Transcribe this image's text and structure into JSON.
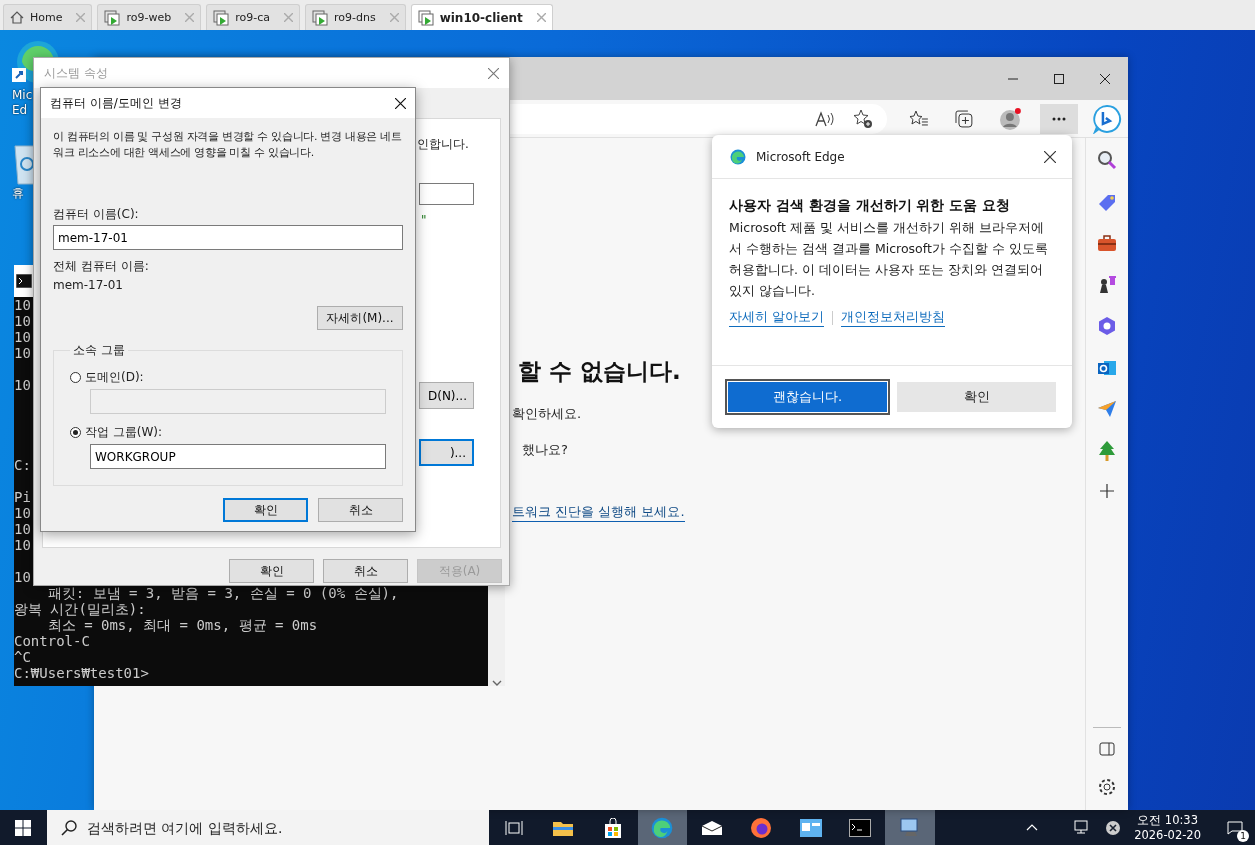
{
  "vm_tabs": [
    {
      "label": "Home",
      "kind": "home",
      "selected": false
    },
    {
      "label": "ro9-web",
      "kind": "vm",
      "selected": false
    },
    {
      "label": "ro9-ca",
      "kind": "vm",
      "selected": false
    },
    {
      "label": "ro9-dns",
      "kind": "vm",
      "selected": false
    },
    {
      "label": "win10-client",
      "kind": "vm",
      "selected": true
    }
  ],
  "desktop_icons": [
    {
      "kind": "edge",
      "label_lines": [
        "Mic",
        "Ed"
      ]
    },
    {
      "kind": "recycle",
      "label_lines": [
        "휴"
      ]
    }
  ],
  "edge_window": {
    "page": {
      "heading": "할 수 없습니다.",
      "lines": [
        "확인하세요.",
        "했나요?"
      ],
      "link": "트워크 진단을 실행해 보세요."
    },
    "popup": {
      "app_name": "Microsoft Edge",
      "heading": "사용자 검색 환경을 개선하기 위한 도움 요청",
      "body": "Microsoft 제품 및 서비스를 개선하기 위해 브라우저에서 수행하는 검색 결과를 Microsoft가 수집할 수 있도록 허용합니다. 이 데이터는 사용자 또는 장치와 연결되어 있지 않습니다.",
      "links": [
        "자세히 알아보기",
        "개인정보처리방침"
      ],
      "buttons": [
        {
          "label": "괜찮습니다.",
          "primary": true
        },
        {
          "label": "확인",
          "primary": false
        }
      ]
    }
  },
  "cmd": {
    "rows": [
      {
        "kind": "text",
        "text": "10"
      },
      {
        "kind": "text",
        "text": "10"
      },
      {
        "kind": "text",
        "text": "10"
      },
      {
        "kind": "text",
        "text": "10"
      },
      {
        "kind": "blank"
      },
      {
        "kind": "text",
        "text": "10"
      },
      {
        "kind": "blank"
      },
      {
        "kind": "blank"
      },
      {
        "kind": "blank"
      },
      {
        "kind": "blank"
      },
      {
        "kind": "text",
        "text": "C:"
      },
      {
        "kind": "blank"
      },
      {
        "kind": "text",
        "text": "Pi"
      },
      {
        "kind": "text",
        "text": "10"
      },
      {
        "kind": "text",
        "text": "10"
      },
      {
        "kind": "text",
        "text": "10"
      },
      {
        "kind": "blank"
      },
      {
        "kind": "text",
        "text": "10"
      },
      {
        "kind": "text",
        "text": "    패킷: 보냄 = 3, 받음 = 3, 손실 = 0 (0% 손실),"
      },
      {
        "kind": "text",
        "text": "왕복 시간(밀리초):"
      },
      {
        "kind": "text",
        "text": "    최소 = 0ms, 최대 = 0ms, 평균 = 0ms"
      },
      {
        "kind": "text",
        "text": "Control-C"
      },
      {
        "kind": "text",
        "text": "^C"
      },
      {
        "kind": "text",
        "text": "C:₩Users₩test01>"
      }
    ]
  },
  "system_properties": {
    "title": "시스템 속성",
    "description_tail": "인합니다.",
    "quote": "\"",
    "partial_buttons": [
      {
        "label": "D(N)...",
        "focused": false
      },
      {
        "label": ")...",
        "focused": true
      }
    ],
    "buttons": [
      {
        "label": "확인",
        "disabled": false
      },
      {
        "label": "취소",
        "disabled": false
      },
      {
        "label": "적용(A)",
        "disabled": true
      }
    ]
  },
  "change_dialog": {
    "title": "컴퓨터 이름/도메인 변경",
    "description": "이 컴퓨터의 이름 및 구성원 자격을 변경할 수 있습니다. 변경 내용은 네트워크 리소스에 대한 액세스에 영향을 미칠 수 있습니다.",
    "computer_name_label": "컴퓨터 이름(C):",
    "computer_name": "mem-17-01",
    "full_name_label": "전체 컴퓨터 이름:",
    "full_name": "mem-17-01",
    "more_button": "자세히(M)...",
    "membership": {
      "legend": "소속 그룹",
      "options": [
        {
          "label": "도메인(D):",
          "selected": false,
          "disabled": true
        },
        {
          "label": "작업 그룹(W):",
          "selected": true,
          "disabled": false,
          "value": "WORKGROUP"
        }
      ]
    },
    "buttons": [
      {
        "label": "확인",
        "focused": true
      },
      {
        "label": "취소",
        "focused": false
      }
    ]
  },
  "taskbar": {
    "search_placeholder": "검색하려면 여기에 입력하세요.",
    "apps": [
      {
        "kind": "taskview",
        "active": false
      },
      {
        "kind": "explorer",
        "active": false
      },
      {
        "kind": "store",
        "active": false
      },
      {
        "kind": "edge",
        "active": true
      },
      {
        "kind": "mail",
        "active": false
      },
      {
        "kind": "firefox",
        "active": false
      },
      {
        "kind": "app",
        "active": false
      },
      {
        "kind": "terminal",
        "active": false
      },
      {
        "kind": "vm",
        "active": true
      }
    ],
    "time": "오전 10:33",
    "date": "2026-02-20",
    "notification_count": "1"
  }
}
